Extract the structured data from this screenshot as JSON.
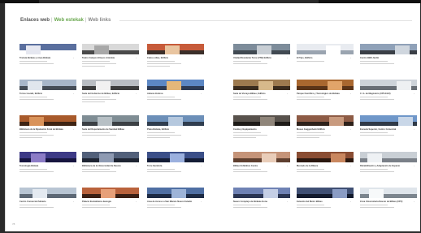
{
  "tabs": [
    "Enlaces web",
    "Web estekak",
    "Web links"
  ],
  "page_number": "78",
  "cards": [
    {
      "title": "Tranvía Bizkaia y Línea Bizkaia",
      "thumb": [
        "#5a6f9e",
        "#ffffff",
        "#e5e7f0"
      ],
      "lines": 2
    },
    {
      "title": "Teatro Campos Elíseos Antzokia",
      "thumb": [
        "#d9d9d9",
        "#4a4a4a",
        "#a8a8a8"
      ],
      "lines": 3
    },
    {
      "title": "Cubos sillas, Edificio",
      "thumb": [
        "#c75b3a",
        "#3b2f2a",
        "#e9c5a0"
      ],
      "lines": 3
    },
    {
      "title": "Unidad Residente Torre (UTB) Edificio",
      "thumb": [
        "#7d8c9a",
        "#414a52",
        "#c8ced4"
      ],
      "lines": 2
    },
    {
      "title": "El Tipo, Edificio",
      "thumb": [
        "#e8ebf0",
        "#9aa4b0",
        "#ffffff"
      ],
      "lines": 1
    },
    {
      "title": "Centro BBK Jardín",
      "thumb": [
        "#8fa1b8",
        "#3a3f46",
        "#cfd6de"
      ],
      "lines": 2
    },
    {
      "title": "Torres Isozaki, Edificio",
      "thumb": [
        "#a7b6c9",
        "#454d57",
        "#e0e6ed"
      ],
      "lines": 2
    },
    {
      "title": "Sede del Gobierno de Bilbao, Edificio",
      "thumb": [
        "#b9bdc2",
        "#3d3d3d",
        "#f1f1f1"
      ],
      "lines": 3
    },
    {
      "title": "Azkuna Zentroa",
      "thumb": [
        "#5c87c4",
        "#2d3b55",
        "#e4b77a"
      ],
      "lines": 2
    },
    {
      "title": "Sede de Vizcaya Bilbao, Edificio",
      "thumb": [
        "#9d7a4f",
        "#3a2c1e",
        "#d7b98b"
      ],
      "lines": 2
    },
    {
      "title": "Parque Científico y Tecnológico de Bizkaia",
      "thumb": [
        "#a9672f",
        "#5b3418",
        "#e1a46a"
      ],
      "lines": 2
    },
    {
      "title": "C. G. de Magisterio (UPV-EHU)",
      "thumb": [
        "#cdd3d9",
        "#686e75",
        "#eef0f2"
      ],
      "lines": 2
    },
    {
      "title": "Biblioteca de la Diputación Foral de Bizkaia",
      "thumb": [
        "#a85a2b",
        "#3f2413",
        "#d9935a"
      ],
      "lines": 3
    },
    {
      "title": "Sede del Departamento de Sanidad Bilbao",
      "thumb": [
        "#7f8d94",
        "#3b4044",
        "#b7c0c5"
      ],
      "lines": 2
    },
    {
      "title": "Plaza Bizkaia, Edificio",
      "thumb": [
        "#6c8fb8",
        "#2f3d4f",
        "#b5c8de"
      ],
      "lines": 3
    },
    {
      "title": "Cocina y Equipamiento",
      "thumb": [
        "#58524c",
        "#1e1b18",
        "#8f857a"
      ],
      "lines": 3
    },
    {
      "title": "Museo Guggenheim Edificio",
      "thumb": [
        "#8d5b45",
        "#2e211a",
        "#c89a7e"
      ],
      "lines": 3
    },
    {
      "title": "Escuela Superior, Centro Comercial",
      "thumb": [
        "#6f97c9",
        "#303a48",
        "#c9d7e8"
      ],
      "lines": 2
    },
    {
      "title": "Tecnología Bizkaia",
      "thumb": [
        "#3d3a86",
        "#17153f",
        "#8c7cc6"
      ],
      "lines": 2
    },
    {
      "title": "Biblioteca de la Universidad de Deusto",
      "thumb": [
        "#52607a",
        "#1f2533",
        "#8e9ab2"
      ],
      "lines": 2
    },
    {
      "title": "Torre Iberdrola",
      "thumb": [
        "#3b4f88",
        "#141d36",
        "#9bb0de"
      ],
      "lines": 2
    },
    {
      "title": "Bilbao Exhibition Centre",
      "thumb": [
        "#c59479",
        "#5e3f2f",
        "#e9cdb9"
      ],
      "lines": 2
    },
    {
      "title": "Mercado de la Ribera",
      "thumb": [
        "#8a4d33",
        "#2b1810",
        "#c9875f"
      ],
      "lines": 2
    },
    {
      "title": "Rehabilitación y Adaptación de Espacio",
      "thumb": [
        "#c9cfd5",
        "#7a8088",
        "#eef1f4"
      ],
      "lines": 2
    },
    {
      "title": "Centro Comercial Zubiarte",
      "thumb": [
        "#b8c5d3",
        "#5d6875",
        "#e4eaf1"
      ],
      "lines": 2
    },
    {
      "title": "Palacio Euskalduna Jauregia",
      "thumb": [
        "#b9623c",
        "#3a1f14",
        "#e7a079"
      ],
      "lines": 2
    },
    {
      "title": "Área de Acceso a San Mamés Nuevo Estadio",
      "thumb": [
        "#4f6fa3",
        "#1c2a44",
        "#9db4d8"
      ],
      "lines": 2
    },
    {
      "title": "Nuevo Complejo de Bizkaia Arena",
      "thumb": [
        "#6f82b4",
        "#2a3552",
        "#c5cfe6"
      ],
      "lines": 2
    },
    {
      "title": "Estación del Metro Bilbao",
      "thumb": [
        "#3f4f73",
        "#121a2c",
        "#8a9cc4"
      ],
      "lines": 2
    },
    {
      "title": "Zona Universitaria Deusto de Bilbao (UPV)",
      "thumb": [
        "#dfe5eb",
        "#7c858e",
        "#f7f9fa"
      ],
      "lines": 2
    }
  ]
}
